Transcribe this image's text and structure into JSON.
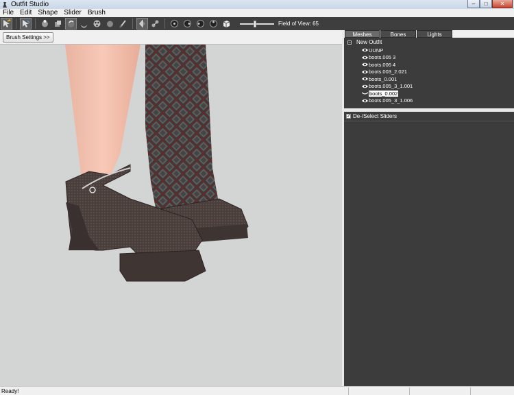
{
  "window": {
    "title": "Outfit Studio",
    "minimize_label": "–",
    "maximize_label": "□",
    "close_label": "✕"
  },
  "menu": [
    "File",
    "Edit",
    "Shape",
    "Slider",
    "Brush"
  ],
  "toolbar": {
    "tools": [
      {
        "name": "select-tool-icon",
        "selected": true
      },
      {
        "name": "transform-tool-icon",
        "selected": true
      },
      {
        "name": "inflate-brush-icon",
        "selected": false
      },
      {
        "name": "deflate-brush-icon",
        "selected": false
      },
      {
        "name": "move-brush-icon",
        "selected": true
      },
      {
        "name": "smooth-brush-icon",
        "selected": false
      },
      {
        "name": "mask-brush-icon",
        "selected": false
      },
      {
        "name": "unmask-brush-icon",
        "selected": false
      },
      {
        "name": "weight-brush-icon",
        "selected": false
      },
      {
        "name": "symmetry-toggle-icon",
        "selected": true
      },
      {
        "name": "connected-only-icon",
        "selected": false
      },
      {
        "name": "view-front-icon",
        "selected": false
      },
      {
        "name": "view-back-icon",
        "selected": false
      },
      {
        "name": "view-left-icon",
        "selected": false
      },
      {
        "name": "view-right-icon",
        "selected": false
      },
      {
        "name": "perspective-toggle-icon",
        "selected": false
      }
    ],
    "fov_label": "Field of View: 65",
    "fov_value": 65
  },
  "viewport": {
    "brush_settings_label": "Brush Settings >>"
  },
  "right_panel": {
    "tabs": [
      "Meshes",
      "Bones",
      "Lights"
    ],
    "active_tab": 0,
    "tree": {
      "root": "New Outfit",
      "items": [
        {
          "label": "UUNP",
          "selected": false
        },
        {
          "label": "boots.005 3",
          "selected": false
        },
        {
          "label": "boots.006 4",
          "selected": false
        },
        {
          "label": "boots.003_2.021",
          "selected": false
        },
        {
          "label": "boots_0.001",
          "selected": false
        },
        {
          "label": "boots.005_3_1.001",
          "selected": false
        },
        {
          "label": "boots_0.002",
          "selected": true
        },
        {
          "label": "boots.005_3_1.006",
          "selected": false
        }
      ]
    },
    "sliders_header": "De-/Select Sliders",
    "sliders_checked": true
  },
  "status": {
    "text": "Ready!"
  },
  "colors": {
    "dark_panel": "#3c3c3c",
    "viewport_bg": "#d3d5d4",
    "toolbar_bg": "#3e3e3e"
  }
}
